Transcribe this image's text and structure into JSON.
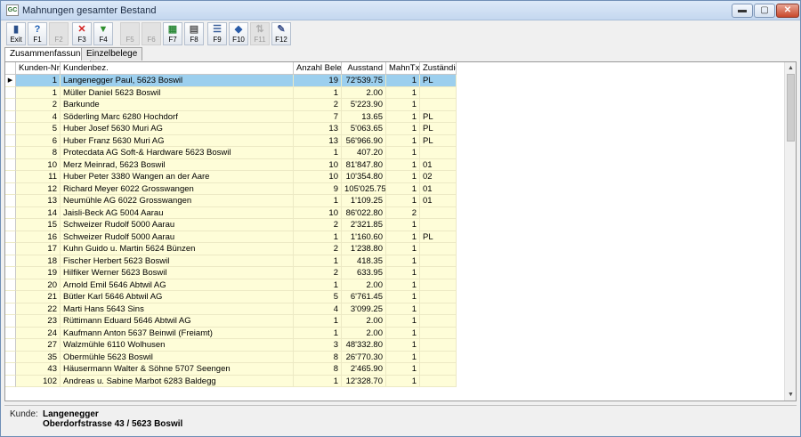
{
  "window": {
    "title": "Mahnungen gesamter Bestand",
    "app_icon_text": "GC",
    "min_glyph": "▬",
    "max_glyph": "▢",
    "close_glyph": "✕"
  },
  "toolbar": {
    "buttons": [
      {
        "label": "Exit",
        "icon": "exit-door-icon",
        "glyph": "▮",
        "color": "#2a4f8a",
        "enabled": true
      },
      {
        "label": "F1",
        "icon": "help-icon",
        "glyph": "?",
        "color": "#1e5fb4",
        "enabled": true
      },
      {
        "label": "F2",
        "icon": "blank-icon",
        "glyph": "",
        "color": "#999999",
        "enabled": false
      },
      {
        "label": "F3",
        "icon": "delete-x-icon",
        "glyph": "✕",
        "color": "#d21e1e",
        "enabled": true
      },
      {
        "label": "F4",
        "icon": "arrow-down-icon",
        "glyph": "▼",
        "color": "#2f8f2f",
        "enabled": true
      },
      {
        "label": "F5",
        "icon": "blank-icon",
        "glyph": "",
        "color": "#999999",
        "enabled": false
      },
      {
        "label": "F6",
        "icon": "blank-icon",
        "glyph": "",
        "color": "#999999",
        "enabled": false
      },
      {
        "label": "F7",
        "icon": "excel-icon",
        "glyph": "▦",
        "color": "#2d8a3a",
        "enabled": true
      },
      {
        "label": "F8",
        "icon": "printer-icon",
        "glyph": "▤",
        "color": "#555555",
        "enabled": true
      },
      {
        "label": "F9",
        "icon": "list-icon",
        "glyph": "☰",
        "color": "#3a5f9a",
        "enabled": true
      },
      {
        "label": "F10",
        "icon": "diamond-icon",
        "glyph": "◆",
        "color": "#2a5ca8",
        "enabled": true
      },
      {
        "label": "F11",
        "icon": "sort-icon",
        "glyph": "⇅",
        "color": "#999999",
        "enabled": false
      },
      {
        "label": "F12",
        "icon": "edit-pencil-icon",
        "glyph": "✎",
        "color": "#3a4f8a",
        "enabled": true
      }
    ]
  },
  "tabs": [
    {
      "label": "Zusammenfassung",
      "active": true
    },
    {
      "label": "Einzelbelege",
      "active": false
    }
  ],
  "table": {
    "columns": {
      "nr": "Kunden-Nr.",
      "name": "Kundenbez.",
      "belege": "Anzahl Belege",
      "ausstand": "Ausstand",
      "mahn": "MahnTxt",
      "zust": "Zuständig"
    },
    "selected_marker": "▶",
    "rows": [
      {
        "nr": "1",
        "name": "Langenegger Paul, 5623 Boswil",
        "belege": "19",
        "ausstand": "72'539.75",
        "mahn": "1",
        "zust": "PL",
        "selected": true
      },
      {
        "nr": "1",
        "name": "Müller Daniel 5623 Boswil",
        "belege": "1",
        "ausstand": "2.00",
        "mahn": "1",
        "zust": ""
      },
      {
        "nr": "2",
        "name": "Barkunde",
        "belege": "2",
        "ausstand": "5'223.90",
        "mahn": "1",
        "zust": ""
      },
      {
        "nr": "4",
        "name": "Söderling Marc 6280 Hochdorf",
        "belege": "7",
        "ausstand": "13.65",
        "mahn": "1",
        "zust": "PL"
      },
      {
        "nr": "5",
        "name": "Huber Josef 5630 Muri AG",
        "belege": "13",
        "ausstand": "5'063.65",
        "mahn": "1",
        "zust": "PL"
      },
      {
        "nr": "6",
        "name": "Huber Franz 5630 Muri AG",
        "belege": "13",
        "ausstand": "56'966.90",
        "mahn": "1",
        "zust": "PL"
      },
      {
        "nr": "8",
        "name": "Protecdata AG Soft-& Hardware 5623 Boswil",
        "belege": "1",
        "ausstand": "407.20",
        "mahn": "1",
        "zust": ""
      },
      {
        "nr": "10",
        "name": "Merz Meinrad, 5623 Boswil",
        "belege": "10",
        "ausstand": "81'847.80",
        "mahn": "1",
        "zust": "01"
      },
      {
        "nr": "11",
        "name": "Huber Peter 3380 Wangen an der Aare",
        "belege": "10",
        "ausstand": "10'354.80",
        "mahn": "1",
        "zust": "02"
      },
      {
        "nr": "12",
        "name": "Richard Meyer 6022 Grosswangen",
        "belege": "9",
        "ausstand": "105'025.75",
        "mahn": "1",
        "zust": "01"
      },
      {
        "nr": "13",
        "name": "Neumühle AG 6022 Grosswangen",
        "belege": "1",
        "ausstand": "1'109.25",
        "mahn": "1",
        "zust": "01"
      },
      {
        "nr": "14",
        "name": "Jaisli-Beck AG 5004 Aarau",
        "belege": "10",
        "ausstand": "86'022.80",
        "mahn": "2",
        "zust": ""
      },
      {
        "nr": "15",
        "name": "Schweizer Rudolf 5000 Aarau",
        "belege": "2",
        "ausstand": "2'321.85",
        "mahn": "1",
        "zust": ""
      },
      {
        "nr": "16",
        "name": "Schweizer Rudolf 5000 Aarau",
        "belege": "1",
        "ausstand": "1'160.60",
        "mahn": "1",
        "zust": "PL"
      },
      {
        "nr": "17",
        "name": "Kuhn Guido u. Martin 5624 Bünzen",
        "belege": "2",
        "ausstand": "1'238.80",
        "mahn": "1",
        "zust": ""
      },
      {
        "nr": "18",
        "name": "Fischer Herbert 5623 Boswil",
        "belege": "1",
        "ausstand": "418.35",
        "mahn": "1",
        "zust": ""
      },
      {
        "nr": "19",
        "name": "Hilfiker Werner 5623 Boswil",
        "belege": "2",
        "ausstand": "633.95",
        "mahn": "1",
        "zust": ""
      },
      {
        "nr": "20",
        "name": "Arnold Emil 5646 Abtwil AG",
        "belege": "1",
        "ausstand": "2.00",
        "mahn": "1",
        "zust": ""
      },
      {
        "nr": "21",
        "name": "Bütler Karl 5646 Abtwil AG",
        "belege": "5",
        "ausstand": "6'761.45",
        "mahn": "1",
        "zust": ""
      },
      {
        "nr": "22",
        "name": "Marti Hans 5643 Sins",
        "belege": "4",
        "ausstand": "3'099.25",
        "mahn": "1",
        "zust": ""
      },
      {
        "nr": "23",
        "name": "Rüttimann Eduard 5646 Abtwil AG",
        "belege": "1",
        "ausstand": "2.00",
        "mahn": "1",
        "zust": ""
      },
      {
        "nr": "24",
        "name": "Kaufmann Anton 5637 Beinwil (Freiamt)",
        "belege": "1",
        "ausstand": "2.00",
        "mahn": "1",
        "zust": ""
      },
      {
        "nr": "27",
        "name": "Walzmühle 6110 Wolhusen",
        "belege": "3",
        "ausstand": "48'332.80",
        "mahn": "1",
        "zust": ""
      },
      {
        "nr": "35",
        "name": "Obermühle 5623 Boswil",
        "belege": "8",
        "ausstand": "26'770.30",
        "mahn": "1",
        "zust": ""
      },
      {
        "nr": "43",
        "name": "Häusermann Walter & Söhne 5707 Seengen",
        "belege": "8",
        "ausstand": "2'465.90",
        "mahn": "1",
        "zust": ""
      },
      {
        "nr": "102",
        "name": "Andreas u. Sabine Marbot 6283 Baldegg",
        "belege": "1",
        "ausstand": "12'328.70",
        "mahn": "1",
        "zust": ""
      }
    ]
  },
  "scrollbar": {
    "up_glyph": "▲",
    "down_glyph": "▼"
  },
  "status": {
    "label": "Kunde:",
    "line1": "Langenegger",
    "line2": "Oberdorfstrasse 43 / 5623 Boswil"
  }
}
